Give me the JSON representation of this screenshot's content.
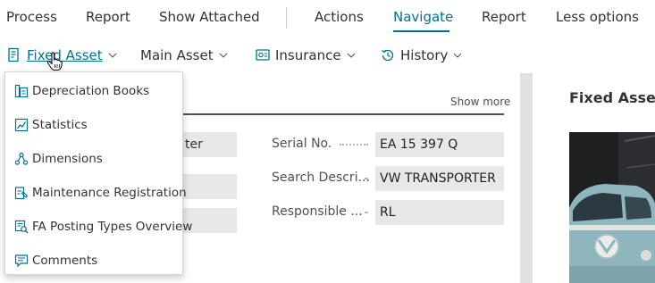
{
  "action_bar": {
    "items": [
      "Process",
      "Report",
      "Show Attached",
      "Actions",
      "Navigate",
      "Report",
      "Less options"
    ],
    "active": "Navigate",
    "accent_color": "#00718f"
  },
  "sub_bar": {
    "items": [
      {
        "label": "Fixed Asset",
        "icon": "fixed-asset-icon"
      },
      {
        "label": "Main Asset",
        "icon": ""
      },
      {
        "label": "Insurance",
        "icon": "insurance-icon"
      },
      {
        "label": "History",
        "icon": "history-icon"
      }
    ]
  },
  "menu": {
    "items": [
      {
        "label": "Depreciation Books",
        "icon": "depreciation-books-icon"
      },
      {
        "label": "Statistics",
        "icon": "statistics-icon"
      },
      {
        "label": "Dimensions",
        "icon": "dimensions-icon"
      },
      {
        "label": "Maintenance Registration",
        "icon": "maintenance-registration-icon"
      },
      {
        "label": "FA Posting Types Overview",
        "icon": "fa-posting-types-overview-icon"
      },
      {
        "label": "Comments",
        "icon": "comments-icon"
      }
    ]
  },
  "general": {
    "show_more": "Show more",
    "left_fields": [
      "ter",
      "",
      ""
    ],
    "fields": [
      {
        "label": "Serial No.",
        "value": "EA 15 397 Q"
      },
      {
        "label": "Search Descri...",
        "value": "VW TRANSPORTER"
      },
      {
        "label": "Responsible ...",
        "value": "RL"
      }
    ]
  },
  "factbox": {
    "title": "Fixed Asset"
  }
}
